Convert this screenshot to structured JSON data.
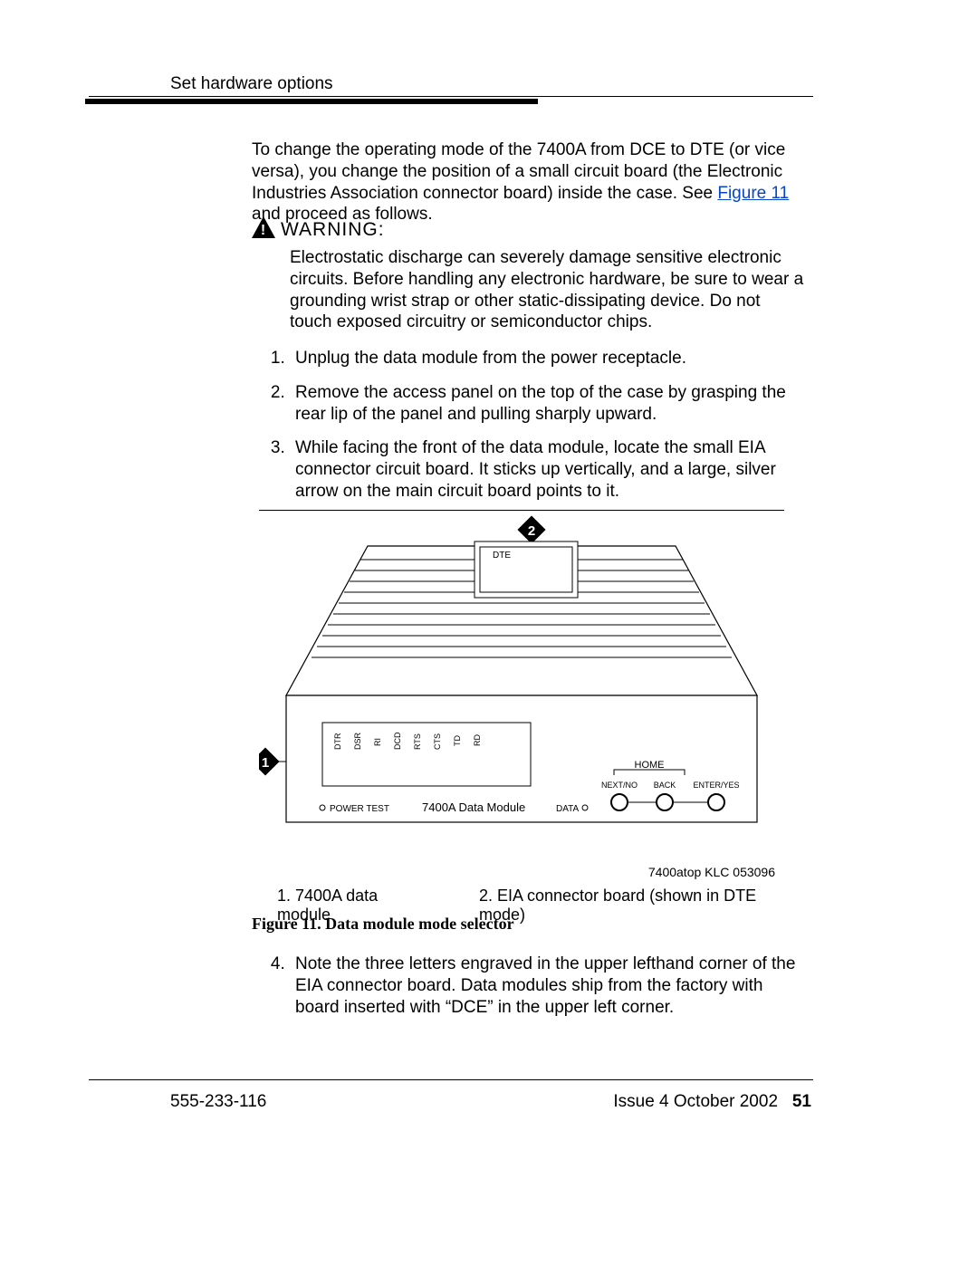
{
  "header": {
    "section_title": "Set hardware options"
  },
  "intro": {
    "text_before_link": "To change the operating mode of the 7400A from DCE to DTE (or vice versa), you change the position of a small circuit board (the Electronic Industries Association connector board) inside the case. See ",
    "link_text": "Figure 11",
    "text_after_link": " and proceed as follows."
  },
  "warning": {
    "label": "WARNING:",
    "body": "Electrostatic discharge can severely damage sensitive electronic circuits. Before handling any electronic hardware, be sure to wear a grounding wrist strap or other static-dissipating device. Do not touch exposed circuitry or semiconductor chips."
  },
  "steps_1_3": [
    "Unplug the data module from the power receptacle.",
    "Remove the access panel on the top of the case by grasping the rear lip of the panel and pulling sharply upward.",
    "While facing the front of the data module, locate the small EIA connector circuit board. It sticks up vertically, and a large, silver arrow on the main circuit board points to it."
  ],
  "figure": {
    "callout1": "1",
    "callout2": "2",
    "board_label": "DTE",
    "led_labels": [
      "DTR",
      "DSR",
      "RI",
      "DCD",
      "RTS",
      "CTS",
      "TD",
      "RD"
    ],
    "home_label": "HOME",
    "btn_labels": [
      "NEXT/NO",
      "BACK",
      "ENTER/YES"
    ],
    "power_label": "POWER TEST",
    "module_label": "7400A Data Module",
    "data_label": "DATA",
    "image_code": "7400atop KLC 053096",
    "legend1": "1. 7400A data module",
    "legend2": "2. EIA connector board (shown in DTE mode)",
    "caption": "Figure 11.    Data module mode selector"
  },
  "step_4": "Note the three letters engraved in the upper lefthand corner of the EIA connector board. Data modules ship from the factory with board inserted with  “DCE” in the upper left corner.",
  "footer": {
    "doc_number": "555-233-116",
    "issue": "Issue 4   October 2002",
    "page": "51"
  }
}
